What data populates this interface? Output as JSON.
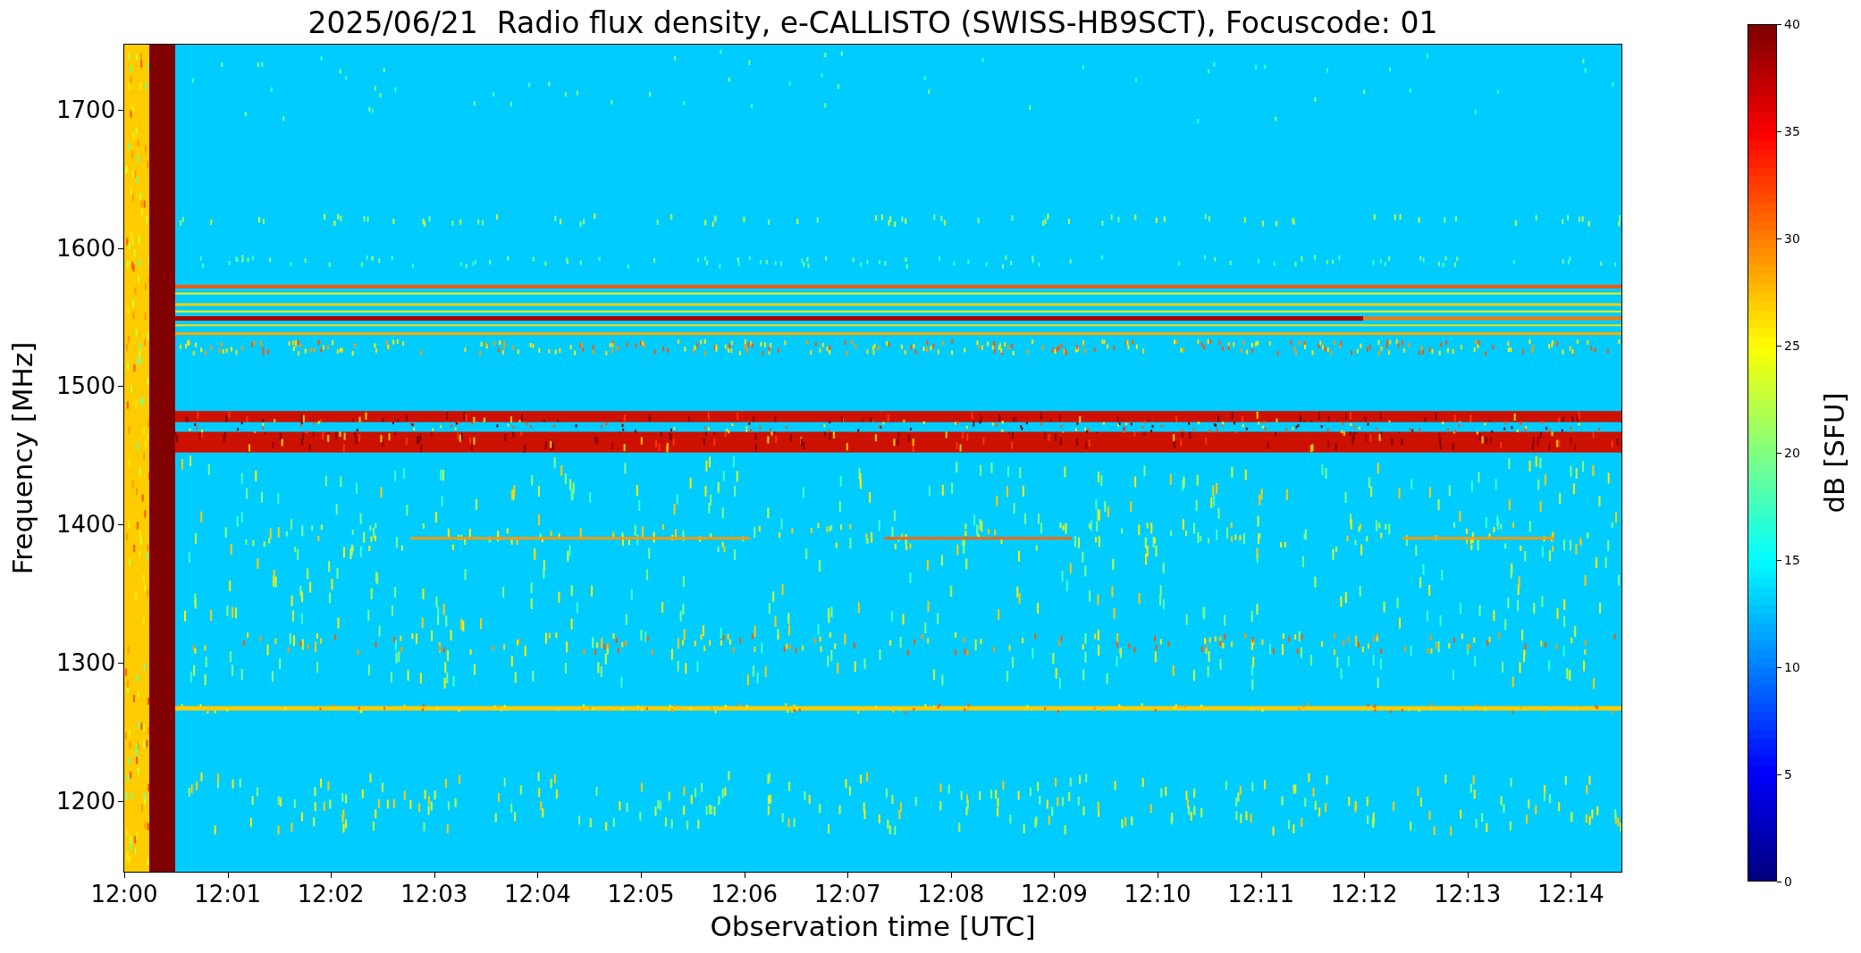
{
  "title": "2025/06/21  Radio flux density, e-CALLISTO (SWISS-HB9SCT), Focuscode: 01",
  "y_axis": {
    "label": "Frequency [MHz]",
    "ticks": [
      "1700",
      "1600",
      "1500",
      "1400",
      "1300",
      "1200"
    ]
  },
  "x_axis": {
    "label": "Observation time [UTC]",
    "ticks": [
      "12:00",
      "12:01",
      "12:02",
      "12:03",
      "12:04",
      "12:05",
      "12:06",
      "12:07",
      "12:08",
      "12:09",
      "12:10",
      "12:11",
      "12:12",
      "12:13",
      "12:14"
    ]
  },
  "colorbar": {
    "label": "dB [SFU]",
    "ticks": [
      "40",
      "35",
      "30",
      "25",
      "20",
      "15",
      "10",
      "5",
      "0"
    ]
  }
}
